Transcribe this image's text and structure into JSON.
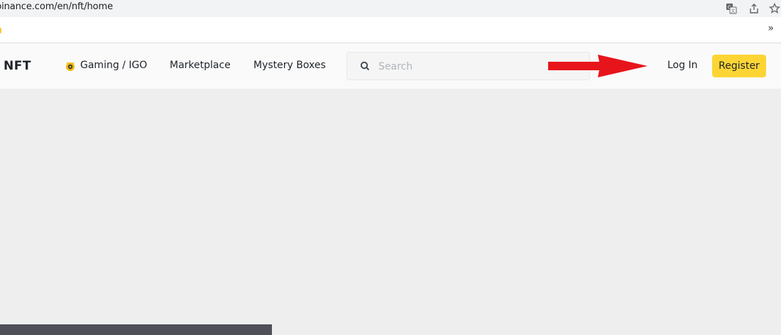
{
  "browser": {
    "url": "binance.com/en/nft/home",
    "icons": [
      "translate-icon",
      "share-icon",
      "bookmark-star-icon"
    ],
    "bookmarks_overflow": "»"
  },
  "header": {
    "logo": "NFT",
    "nav": [
      {
        "label": "Gaming / IGO",
        "icon": "gaming-icon"
      },
      {
        "label": "Marketplace"
      },
      {
        "label": "Mystery Boxes"
      }
    ],
    "search": {
      "placeholder": "Search",
      "value": ""
    },
    "login_label": "Log In",
    "register_label": "Register"
  },
  "colors": {
    "accent": "#fcd535",
    "annotation_arrow": "#e8141b",
    "page_bg": "#eeeeee",
    "header_bg": "#fafafa"
  }
}
